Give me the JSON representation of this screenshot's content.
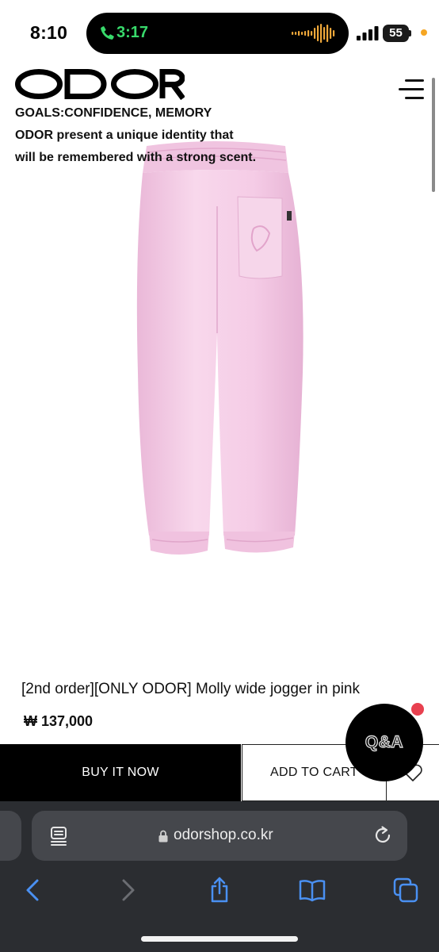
{
  "status_bar": {
    "time": "8:10",
    "call_duration": "3:17",
    "battery_level": "55",
    "call_color": "#38d96b",
    "privacy_dot_color": "#f5a623"
  },
  "header": {
    "logo_text": "ODOR",
    "tagline_line1": "GOALS:CONFIDENCE, MEMORY",
    "tagline_line2": "ODOR present a unique identity that",
    "tagline_line3": "will be remembered with a strong scent.",
    "menu_icon": "hamburger-menu-icon"
  },
  "product": {
    "name": "[2nd order][ONLY ODOR] Molly wide jogger in pink",
    "price": "₩ 137,000",
    "image_color": "#f7cfe8"
  },
  "actions": {
    "buy_now_label": "BUY IT NOW",
    "add_to_cart_label": "ADD TO CART",
    "wishlist_icon": "heart-icon",
    "qa_label": "Q&A",
    "qa_badge_color": "#e8404f"
  },
  "browser": {
    "url": "odorshop.co.kr",
    "toolbar": [
      "back-icon",
      "forward-icon",
      "share-icon",
      "bookmarks-icon",
      "tabs-icon"
    ],
    "theme_color": "#2b2d31"
  }
}
